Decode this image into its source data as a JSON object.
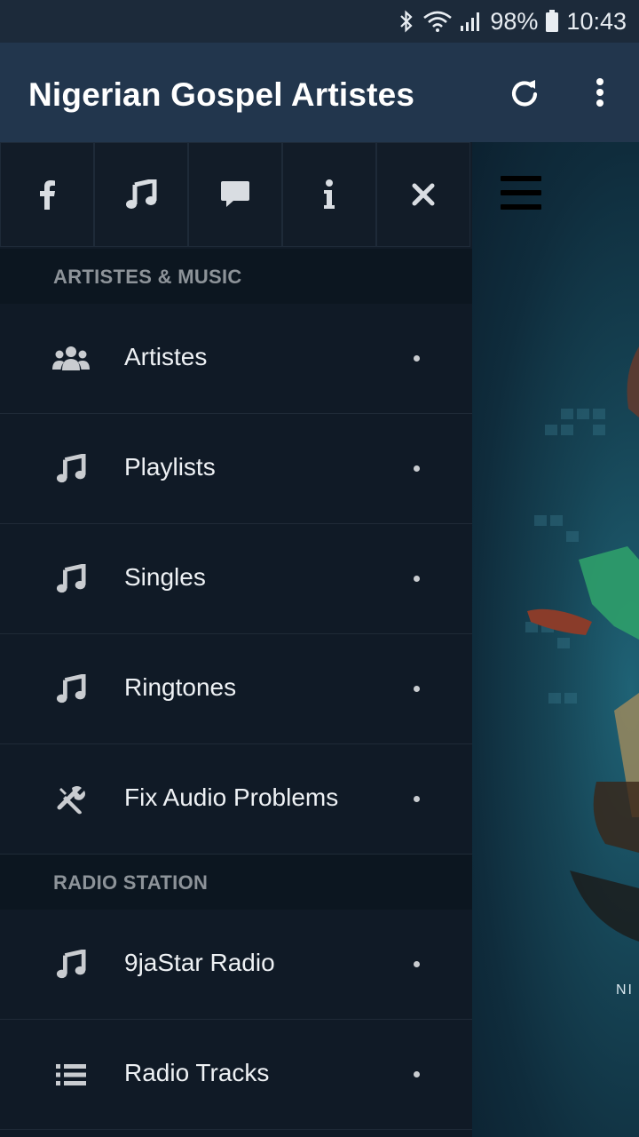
{
  "status_bar": {
    "battery": "98%",
    "time": "10:43",
    "icons": [
      "bluetooth-icon",
      "wifi-icon",
      "signal-icon",
      "battery-icon"
    ]
  },
  "app_bar": {
    "title": "Nigerian Gospel Artistes",
    "actions": [
      "refresh-icon",
      "more-vert-icon"
    ]
  },
  "drawer": {
    "quick_icons": [
      "facebook-icon",
      "music-note-icon",
      "chat-icon",
      "info-icon",
      "close-icon"
    ],
    "sections": [
      {
        "title": "ARTISTES & MUSIC",
        "items": [
          {
            "label": "Artistes",
            "icon": "group-icon"
          },
          {
            "label": "Playlists",
            "icon": "music-note-icon"
          },
          {
            "label": "Singles",
            "icon": "music-note-icon"
          },
          {
            "label": "Ringtones",
            "icon": "music-note-icon"
          },
          {
            "label": "Fix Audio Problems",
            "icon": "tools-icon"
          }
        ]
      },
      {
        "title": "RADIO STATION",
        "items": [
          {
            "label": "9jaStar Radio",
            "icon": "music-note-icon"
          },
          {
            "label": "Radio Tracks",
            "icon": "list-icon"
          }
        ]
      }
    ]
  },
  "content": {
    "menu_icon": "hamburger-icon",
    "partial_text": "NI",
    "background_colors": [
      "#1f6275",
      "#0c2130"
    ]
  }
}
